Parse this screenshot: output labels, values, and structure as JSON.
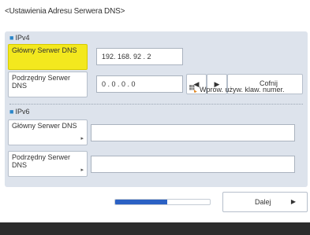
{
  "title": "<Ustawienia Adresu Serwera DNS>",
  "ipv4": {
    "heading": "IPv4",
    "primary_label": "Główny Serwer DNS",
    "primary_value": "192. 168. 92 . 2",
    "secondary_label": "Podrzędny Serwer DNS",
    "secondary_value": "0 . 0 . 0 . 0",
    "keypad_text": "Wprow. używ. klaw. numer.",
    "back_label": "Cofnij",
    "prev_arrow": "◀",
    "next_arrow": "▶"
  },
  "ipv6": {
    "heading": "IPv6",
    "primary_label": "Główny Serwer DNS",
    "primary_value": "",
    "secondary_label": "Podrzędny Serwer DNS",
    "secondary_value": ""
  },
  "footer": {
    "next_label": "Dalej",
    "next_arrow": "▶",
    "progress_fraction": 0.55
  },
  "colors": {
    "accent": "#2a86c9",
    "selected": "#f3e81e",
    "progress": "#2b61c4",
    "footer_bar": "#2c2c2c"
  }
}
